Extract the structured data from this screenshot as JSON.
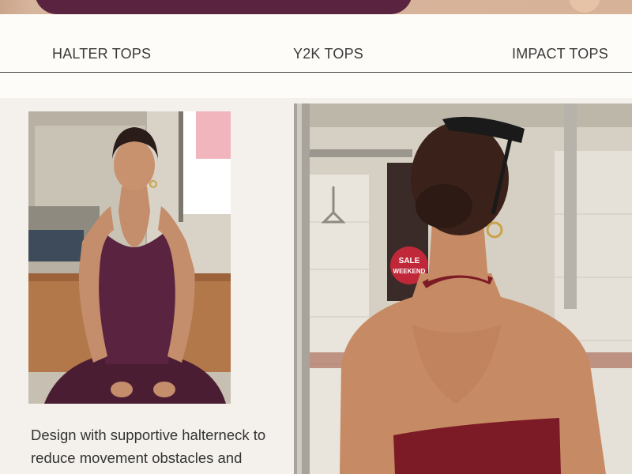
{
  "nav": {
    "tabs": [
      {
        "label": "HALTER TOPS"
      },
      {
        "label": "Y2K TOPS"
      },
      {
        "label": "IMPACT TOPS"
      }
    ]
  },
  "photo_left": {
    "alt": "Model sitting on a subway bench wearing a burgundy halter top and leggings",
    "sign_text": ""
  },
  "photo_right": {
    "alt": "Model seen from behind wearing a red halterneck top in a subway car",
    "sign_lines": [
      "SALE",
      "WEEKEND"
    ]
  },
  "description": {
    "text": "Design with supportive halterneck to reduce movement obstacles and"
  },
  "colors": {
    "page_bg": "#f4f1ed",
    "nav_bg": "#fdfcf8",
    "garment_plum": "#5a2440",
    "garment_red": "#7c1a26"
  }
}
